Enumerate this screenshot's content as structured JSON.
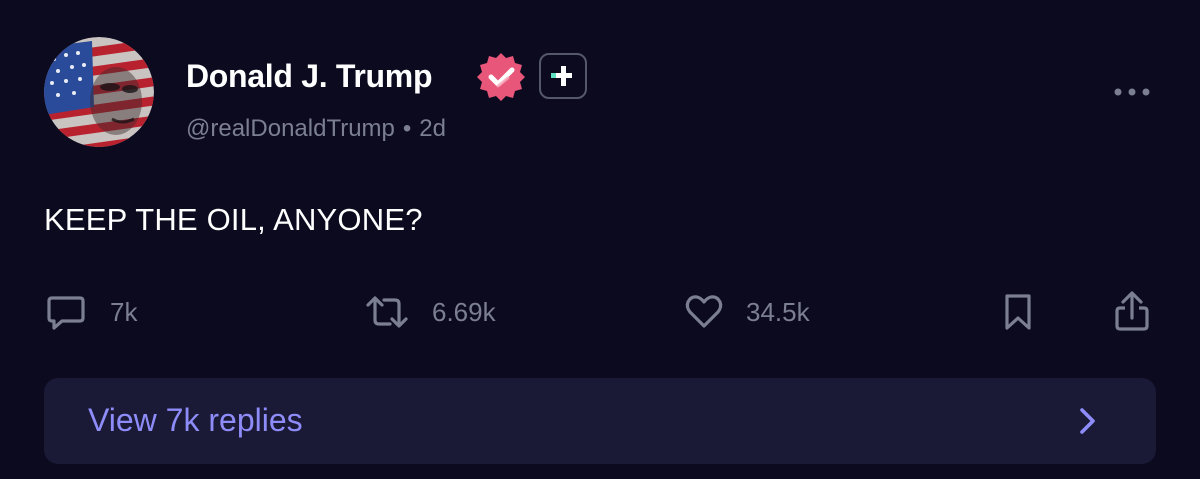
{
  "author": {
    "name": "Donald J. Trump",
    "handle": "@realDonaldTrump",
    "separator": "•",
    "time_ago": "2d",
    "avatar_icon": "flag-portrait-avatar",
    "verified_icon": "verified-badge-icon",
    "plus_icon": "plus-badge-icon"
  },
  "post": {
    "text": "KEEP THE OIL, ANYONE?"
  },
  "actions": {
    "reply_count": "7k",
    "repost_count": "6.69k",
    "like_count": "34.5k"
  },
  "replies": {
    "label": "View 7k replies"
  },
  "colors": {
    "background": "#0c0a1f",
    "muted_text": "#7b7f91",
    "verified": "#e8567a",
    "plus_accent": "#5ee0c0",
    "replies_bar": "#1a1936",
    "replies_text": "#8e8cf8"
  }
}
